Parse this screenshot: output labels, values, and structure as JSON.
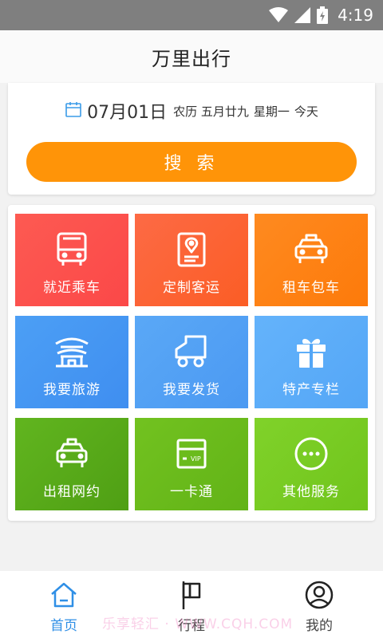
{
  "status_bar": {
    "time": "4:19"
  },
  "header": {
    "title": "万里出行"
  },
  "date_card": {
    "date": "07月01日",
    "lunar": "农历 五月廿九",
    "weekday": "星期一",
    "relative_day": "今天",
    "search_label": "搜 索"
  },
  "services": [
    {
      "label": "就近乘车",
      "icon": "bus-icon"
    },
    {
      "label": "定制客运",
      "icon": "location-document-icon"
    },
    {
      "label": "租车包车",
      "icon": "taxi-car-icon"
    },
    {
      "label": "我要旅游",
      "icon": "pavilion-icon"
    },
    {
      "label": "我要发货",
      "icon": "truck-icon"
    },
    {
      "label": "特产专栏",
      "icon": "gift-icon"
    },
    {
      "label": "出租网约",
      "icon": "cab-icon"
    },
    {
      "label": "一卡通",
      "icon": "vip-card-icon"
    },
    {
      "label": "其他服务",
      "icon": "more-dots-icon"
    }
  ],
  "tab_bar": {
    "items": [
      {
        "label": "首页",
        "icon": "home-icon",
        "active": true
      },
      {
        "label": "行程",
        "icon": "flag-icon",
        "active": false
      },
      {
        "label": "我的",
        "icon": "user-icon",
        "active": false
      }
    ]
  },
  "colors": {
    "accent": "#ff9408",
    "tab_active": "#2f8fe6"
  },
  "watermark": "乐享轻汇 · WWW.CQH.COM"
}
